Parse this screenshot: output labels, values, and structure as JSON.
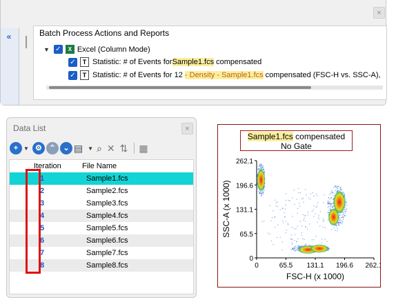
{
  "batch": {
    "header": "Batch Process Actions and Reports",
    "tree": {
      "root": "Excel (Column Mode)",
      "items": [
        {
          "prefix": "Statistic: # of Events for ",
          "highlight": "Sample1.fcs",
          "suffix": " compensated"
        },
        {
          "prefix": "Statistic: # of Events for 12 ",
          "orange": "- Density - ",
          "highlight": "Sample1.fcs",
          "suffix": " compensated (FSC-H vs. SSC-A),"
        }
      ]
    },
    "close": "×"
  },
  "datalist": {
    "title": "Data List",
    "close": "×",
    "columns": {
      "iteration": "Iteration",
      "filename": "File Name"
    },
    "rows": [
      {
        "iteration": "1",
        "file": "Sample1.fcs"
      },
      {
        "iteration": "2",
        "file": "Sample2.fcs"
      },
      {
        "iteration": "3",
        "file": "Sample3.fcs"
      },
      {
        "iteration": "4",
        "file": "Sample4.fcs"
      },
      {
        "iteration": "5",
        "file": "Sample5.fcs"
      },
      {
        "iteration": "6",
        "file": "Sample6.fcs"
      },
      {
        "iteration": "7",
        "file": "Sample7.fcs"
      },
      {
        "iteration": "8",
        "file": "Sample8.fcs"
      }
    ],
    "selected_row": 0,
    "toolbar_icons": [
      "add-icon",
      "wrench-icon",
      "up-icon",
      "down-icon",
      "list-icon",
      "search-icon",
      "delete-icon",
      "sort-icon",
      "report-icon"
    ]
  },
  "plot": {
    "title_highlight": "Sample1.fcs",
    "title_rest": " compensated",
    "subtitle": "No Gate",
    "xlabel": "FSC-H (x 1000)",
    "ylabel": "SSC-A (x 1000)",
    "xticks": [
      "0",
      "65.5",
      "131.1",
      "196.6",
      "262.1"
    ],
    "yticks": [
      "0",
      "65.5",
      "131.1",
      "196.6",
      "262.1"
    ]
  },
  "chart_data": {
    "type": "scatter",
    "title": "Sample1.fcs compensated",
    "subtitle": "No Gate",
    "xlabel": "FSC-H (x 1000)",
    "ylabel": "SSC-A (x 1000)",
    "xlim": [
      0,
      262.1
    ],
    "ylim": [
      0,
      262.1
    ],
    "populations": [
      {
        "x": 10,
        "y": 210
      },
      {
        "x": 185,
        "y": 150
      },
      {
        "x": 172,
        "y": 110
      },
      {
        "x": 115,
        "y": 22
      },
      {
        "x": 140,
        "y": 25
      }
    ]
  },
  "colors": {
    "selection": "#12d4d4",
    "iteration_text": "#1a58c0",
    "red_box": "#e01010",
    "frame": "#8e1010",
    "highlight": "#fbef9f"
  }
}
